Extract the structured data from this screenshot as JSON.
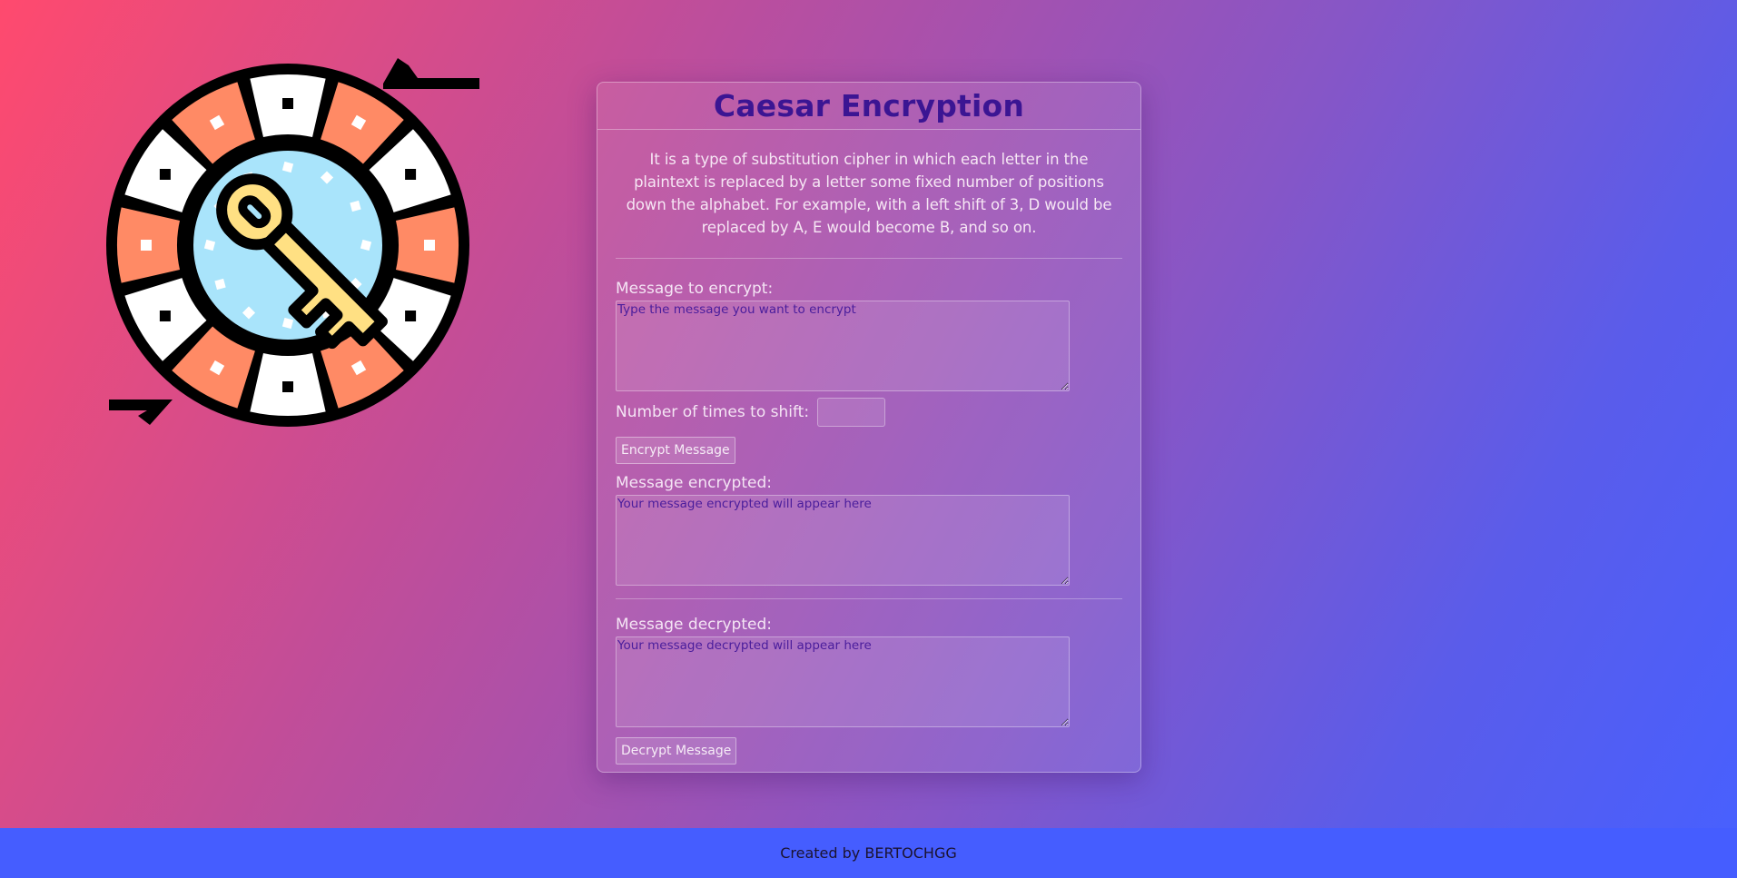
{
  "logo": {
    "icon": "caesar-cipher-key-wheel-icon"
  },
  "card": {
    "title": "Caesar Encryption",
    "description": "It is a type of substitution cipher in which each letter in the plaintext is replaced by a letter some fixed number of positions down the alphabet. For example, with a left shift of 3, D would be replaced by A, E would become B, and so on."
  },
  "encrypt": {
    "label": "Message to encrypt:",
    "placeholder": "Type the message you want to encrypt",
    "shift_label": "Number of times to shift:",
    "shift_value": "",
    "button_label": "Encrypt Message"
  },
  "encrypted": {
    "label": "Message encrypted:",
    "placeholder": "Your message encrypted will appear here"
  },
  "decrypted": {
    "label": "Message decrypted:",
    "placeholder": "Your message decrypted will appear here",
    "button_label": "Decrypt Message"
  },
  "footer": {
    "text": "Created by BERTOCHGG"
  },
  "colors": {
    "title": "#3b1593",
    "footer_bg": "#455dff",
    "wheel_orange": "#ff8a65",
    "wheel_blue": "#a9e4fb",
    "key_yellow": "#ffe083"
  }
}
